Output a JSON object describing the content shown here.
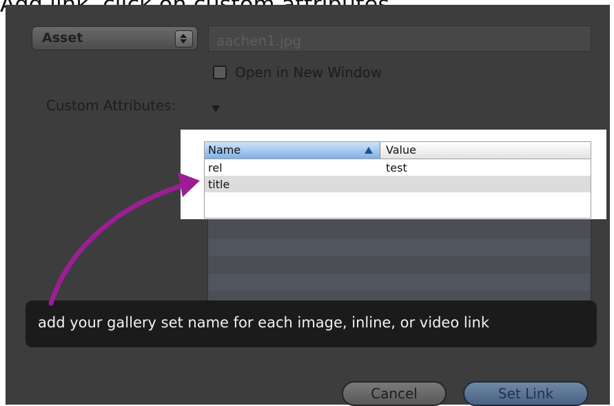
{
  "heading": "Add link, click on custom attributes",
  "link_type": {
    "selected": "Asset"
  },
  "url_field": {
    "value": "aachen1.jpg"
  },
  "open_new_window": {
    "label": "Open in New Window",
    "checked": false
  },
  "custom_attributes": {
    "label": "Custom Attributes:"
  },
  "attributes_table": {
    "columns": [
      "Name",
      "Value"
    ],
    "sort_column": "Name",
    "rows": [
      {
        "name": "rel",
        "value": "test"
      },
      {
        "name": "title",
        "value": ""
      }
    ]
  },
  "callout": {
    "text": "add your gallery set name for each image, inline, or video link"
  },
  "buttons": {
    "cancel": "Cancel",
    "set_link": "Set Link"
  },
  "colors": {
    "arrow": "#9b1f93",
    "panel_bg": "#3d3d3d",
    "default_button": "#5a7396"
  }
}
